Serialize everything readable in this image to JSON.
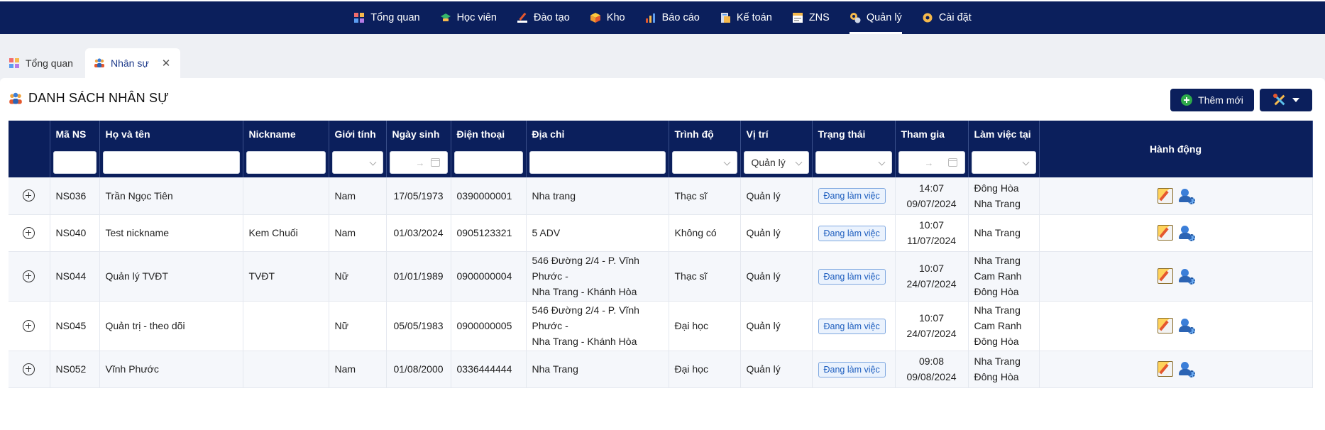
{
  "nav": {
    "items": [
      {
        "label": "Tổng quan",
        "icon": "dashboard-icon",
        "active": false
      },
      {
        "label": "Học viên",
        "icon": "graduation-cap-icon",
        "active": false
      },
      {
        "label": "Đào tạo",
        "icon": "pen-icon",
        "active": false
      },
      {
        "label": "Kho",
        "icon": "box-icon",
        "active": false
      },
      {
        "label": "Báo cáo",
        "icon": "bar-chart-icon",
        "active": false
      },
      {
        "label": "Kế toán",
        "icon": "accounting-icon",
        "active": false
      },
      {
        "label": "ZNS",
        "icon": "message-icon",
        "active": false
      },
      {
        "label": "Quản lý",
        "icon": "manage-gear-icon",
        "active": true
      },
      {
        "label": "Cài đặt",
        "icon": "settings-icon",
        "active": false
      }
    ]
  },
  "tabs": [
    {
      "label": "Tổng quan"
    },
    {
      "label": "Nhân sự",
      "closable": true
    }
  ],
  "page": {
    "title": "DANH SÁCH NHÂN SỰ",
    "add_button": "Thêm mới"
  },
  "table": {
    "columns": [
      "",
      "Mã NS",
      "Họ và tên",
      "Nickname",
      "Giới tính",
      "Ngày sinh",
      "Điện thoại",
      "Địa chỉ",
      "Trình độ",
      "Vị trí",
      "Trạng thái",
      "Tham gia",
      "Làm việc tại",
      "Hành động"
    ],
    "filters": {
      "position_value": "Quản lý",
      "date_arrow": "→"
    },
    "rows": [
      {
        "id": "NS036",
        "name": "Trần Ngọc Tiên",
        "nickname": "",
        "gender": "Nam",
        "dob": "17/05/1973",
        "phone": "0390000001",
        "address": [
          "Nha trang"
        ],
        "level": "Thạc sĩ",
        "position": "Quản lý",
        "status": "Đang làm việc",
        "joined_time": "14:07",
        "joined_date": "09/07/2024",
        "workplaces": [
          "Đông Hòa",
          "Nha Trang"
        ]
      },
      {
        "id": "NS040",
        "name": "Test nickname",
        "nickname": "Kem Chuối",
        "gender": "Nam",
        "dob": "01/03/2024",
        "phone": "0905123321",
        "address": [
          "5 ADV"
        ],
        "level": "Không có",
        "position": "Quản lý",
        "status": "Đang làm việc",
        "joined_time": "10:07",
        "joined_date": "11/07/2024",
        "workplaces": [
          "Nha Trang"
        ]
      },
      {
        "id": "NS044",
        "name": "Quản lý TVĐT",
        "nickname": "TVĐT",
        "gender": "Nữ",
        "dob": "01/01/1989",
        "phone": "0900000004",
        "address": [
          "546 Đường 2/4 - P. Vĩnh Phước -",
          "Nha Trang - Khánh Hòa"
        ],
        "level": "Thạc sĩ",
        "position": "Quản lý",
        "status": "Đang làm việc",
        "joined_time": "10:07",
        "joined_date": "24/07/2024",
        "workplaces": [
          "Nha Trang",
          "Cam Ranh",
          "Đông Hòa"
        ]
      },
      {
        "id": "NS045",
        "name": "Quản trị - theo dõi",
        "nickname": "",
        "gender": "Nữ",
        "dob": "05/05/1983",
        "phone": "0900000005",
        "address": [
          "546 Đường 2/4 - P. Vĩnh Phước -",
          "Nha Trang - Khánh Hòa"
        ],
        "level": "Đại học",
        "position": "Quản lý",
        "status": "Đang làm việc",
        "joined_time": "10:07",
        "joined_date": "24/07/2024",
        "workplaces": [
          "Nha Trang",
          "Cam Ranh",
          "Đông Hòa"
        ]
      },
      {
        "id": "NS052",
        "name": "Vĩnh Phước",
        "nickname": "",
        "gender": "Nam",
        "dob": "01/08/2000",
        "phone": "0336444444",
        "address": [
          "Nha Trang"
        ],
        "level": "Đại học",
        "position": "Quản lý",
        "status": "Đang làm việc",
        "joined_time": "09:08",
        "joined_date": "09/08/2024",
        "workplaces": [
          "Nha Trang",
          "Đông Hòa"
        ]
      }
    ]
  },
  "colors": {
    "nav_bg": "#0b1f5c",
    "badge_text": "#1f5fbf"
  }
}
